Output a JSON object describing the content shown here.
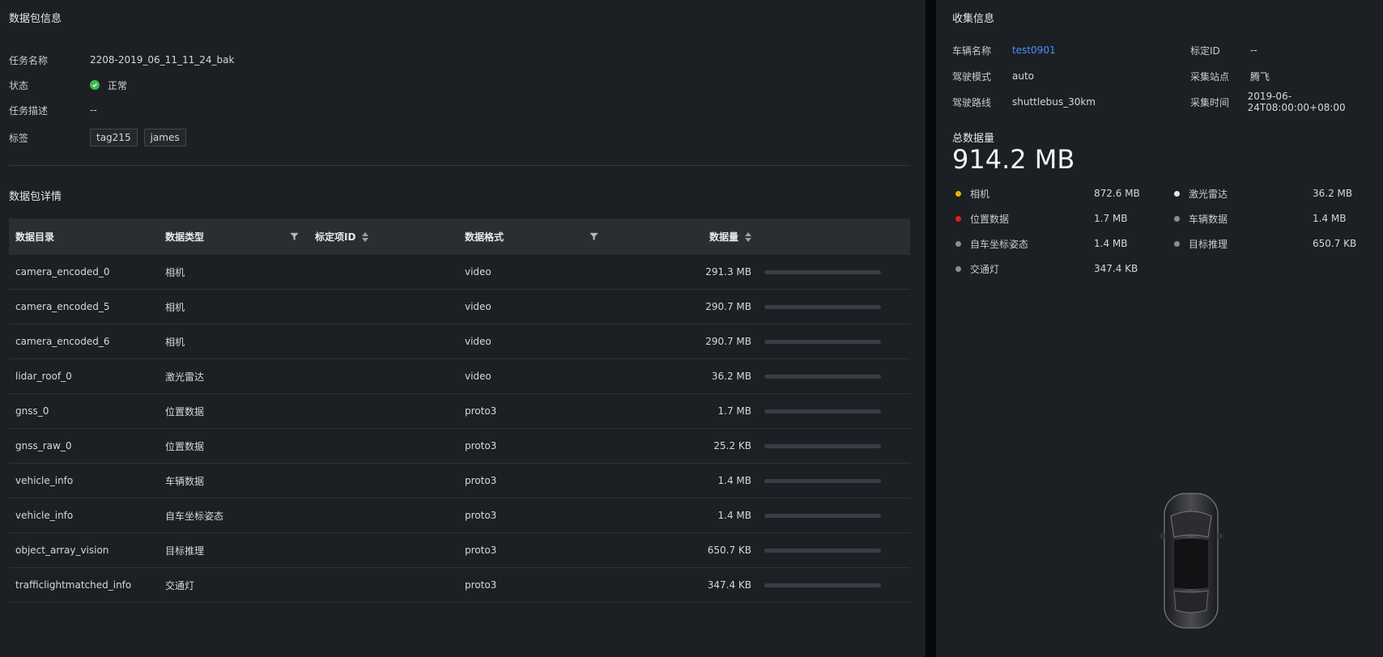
{
  "package_info": {
    "title": "数据包信息",
    "rows": {
      "task_name_label": "任务名称",
      "task_name_value": "2208-2019_06_11_11_24_bak",
      "status_label": "状态",
      "status_value": "正常",
      "desc_label": "任务描述",
      "desc_value": "--",
      "tags_label": "标签",
      "tags": [
        "tag215",
        "james"
      ]
    }
  },
  "package_detail": {
    "title": "数据包详情",
    "columns": [
      "数据目录",
      "数据类型",
      "标定项ID",
      "数据格式",
      "数据量"
    ],
    "rows": [
      {
        "dir": "camera_encoded_0",
        "type": "相机",
        "calib": "",
        "format": "video",
        "size": "291.3 MB",
        "fraction": 0.0
      },
      {
        "dir": "camera_encoded_5",
        "type": "相机",
        "calib": "",
        "format": "video",
        "size": "290.7 MB",
        "fraction": 0.0
      },
      {
        "dir": "camera_encoded_6",
        "type": "相机",
        "calib": "",
        "format": "video",
        "size": "290.7 MB",
        "fraction": 0.0
      },
      {
        "dir": "lidar_roof_0",
        "type": "激光雷达",
        "calib": "",
        "format": "video",
        "size": "36.2 MB",
        "fraction": 0.0
      },
      {
        "dir": "gnss_0",
        "type": "位置数据",
        "calib": "",
        "format": "proto3",
        "size": "1.7 MB",
        "fraction": 0.0
      },
      {
        "dir": "gnss_raw_0",
        "type": "位置数据",
        "calib": "",
        "format": "proto3",
        "size": "25.2 KB",
        "fraction": 0.0
      },
      {
        "dir": "vehicle_info",
        "type": "车辆数据",
        "calib": "",
        "format": "proto3",
        "size": "1.4 MB",
        "fraction": 0.0
      },
      {
        "dir": "vehicle_info",
        "type": "自车坐标姿态",
        "calib": "",
        "format": "proto3",
        "size": "1.4 MB",
        "fraction": 0.0
      },
      {
        "dir": "object_array_vision",
        "type": "目标推理",
        "calib": "",
        "format": "proto3",
        "size": "650.7 KB",
        "fraction": 0.0
      },
      {
        "dir": "trafficlightmatched_info",
        "type": "交通灯",
        "calib": "",
        "format": "proto3",
        "size": "347.4 KB",
        "fraction": 0.0
      }
    ]
  },
  "collect_info": {
    "title": "收集信息",
    "fields": [
      {
        "label": "车辆名称",
        "value": "test0901",
        "link": true
      },
      {
        "label": "标定ID",
        "value": "--",
        "link": false
      },
      {
        "label": "驾驶模式",
        "value": "auto",
        "link": false
      },
      {
        "label": "采集站点",
        "value": "腾飞",
        "link": false
      },
      {
        "label": "驾驶路线",
        "value": "shuttlebus_30km",
        "link": false
      },
      {
        "label": "采集时间",
        "value": "2019-06-24T08:00:00+08:00",
        "link": false
      }
    ],
    "total_label": "总数据量",
    "total_value": "914.2 MB",
    "breakdown": [
      {
        "name": "相机",
        "value": "872.6 MB",
        "color": "#e8b21a"
      },
      {
        "name": "激光雷达",
        "value": "36.2 MB",
        "color": "#e8e8e8"
      },
      {
        "name": "位置数据",
        "value": "1.7 MB",
        "color": "#e01e1e"
      },
      {
        "name": "车辆数据",
        "value": "1.4 MB",
        "color": "#8a8d91"
      },
      {
        "name": "自车坐标姿态",
        "value": "1.4 MB",
        "color": "#8a8d91"
      },
      {
        "name": "目标推理",
        "value": "650.7 KB",
        "color": "#8a8d91"
      },
      {
        "name": "交通灯",
        "value": "347.4 KB",
        "color": "#8a8d91"
      }
    ]
  }
}
